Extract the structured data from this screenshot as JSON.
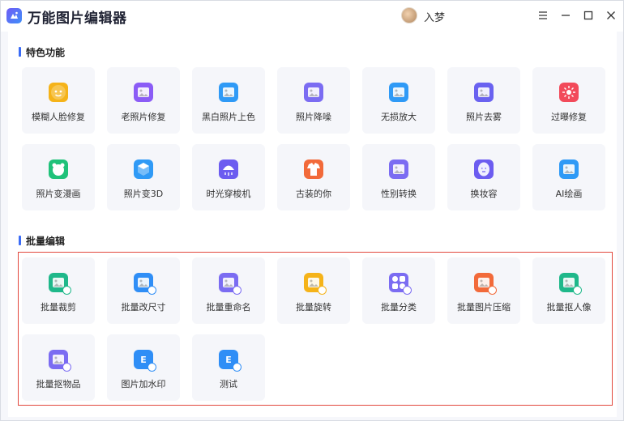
{
  "app": {
    "title": "万能图片编辑器",
    "user_name": "入梦"
  },
  "sections": {
    "featured": {
      "title": "特色功能",
      "items": [
        {
          "label": "模糊人脸修复",
          "icon": "face-repair-icon",
          "color": "#f5b319"
        },
        {
          "label": "老照片修复",
          "icon": "old-photo-icon",
          "color": "#8b5cf6"
        },
        {
          "label": "黑白照片上色",
          "icon": "palette-icon",
          "color": "#2f9af6"
        },
        {
          "label": "照片降噪",
          "icon": "denoise-icon",
          "color": "#7b6cf2"
        },
        {
          "label": "无损放大",
          "icon": "enlarge-icon",
          "color": "#2f9af6"
        },
        {
          "label": "照片去雾",
          "icon": "defog-icon",
          "color": "#6a62f0"
        },
        {
          "label": "过曝修复",
          "icon": "sun-icon",
          "color": "#f24a5a"
        },
        {
          "label": "照片变漫画",
          "icon": "cartoon-icon",
          "color": "#20c27a"
        },
        {
          "label": "照片变3D",
          "icon": "cube-3d-icon",
          "color": "#2f9af6"
        },
        {
          "label": "时光穿梭机",
          "icon": "time-machine-icon",
          "color": "#6c5cf0"
        },
        {
          "label": "古装的你",
          "icon": "costume-icon",
          "color": "#f26a3a"
        },
        {
          "label": "性别转换",
          "icon": "gender-swap-icon",
          "color": "#7b6cf2"
        },
        {
          "label": "换妆容",
          "icon": "makeup-icon",
          "color": "#6c5cf0"
        },
        {
          "label": "AI绘画",
          "icon": "ai-paint-icon",
          "color": "#2f9af6"
        }
      ]
    },
    "batch": {
      "title": "批量编辑",
      "items": [
        {
          "label": "批量裁剪",
          "icon": "crop-icon",
          "color": "#1fb88a"
        },
        {
          "label": "批量改尺寸",
          "icon": "resize-icon",
          "color": "#2f8ef6"
        },
        {
          "label": "批量重命名",
          "icon": "rename-icon",
          "color": "#7b6cf2"
        },
        {
          "label": "批量旋转",
          "icon": "rotate-icon",
          "color": "#f5b319"
        },
        {
          "label": "批量分类",
          "icon": "classify-icon",
          "color": "#7b6cf2"
        },
        {
          "label": "批量图片压缩",
          "icon": "compress-icon",
          "color": "#f26a3a"
        },
        {
          "label": "批量抠人像",
          "icon": "portrait-cutout-icon",
          "color": "#1fb88a"
        },
        {
          "label": "批量抠物品",
          "icon": "object-cutout-icon",
          "color": "#7b6cf2"
        },
        {
          "label": "图片加水印",
          "icon": "watermark-icon",
          "color": "#2f8ef6"
        },
        {
          "label": "测试",
          "icon": "test-icon",
          "color": "#2f8ef6"
        }
      ]
    }
  }
}
